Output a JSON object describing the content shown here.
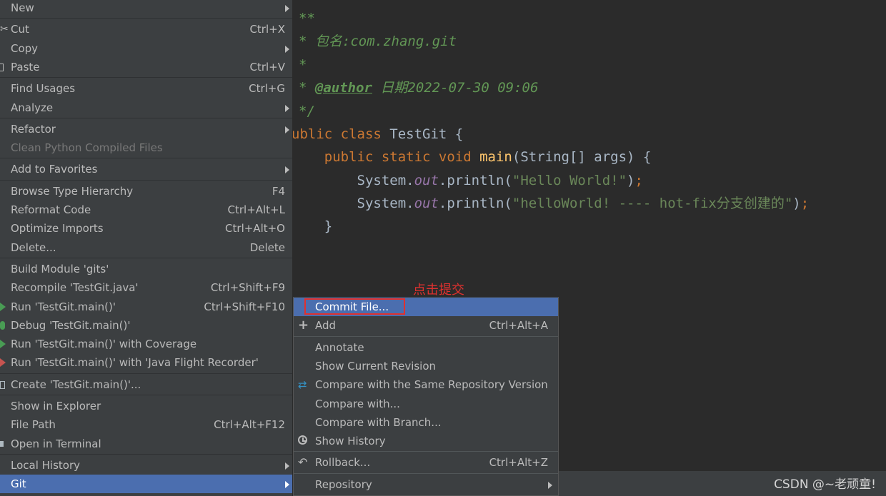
{
  "editor": {
    "lines": [
      {
        "parts": [
          {
            "cls": "cm",
            "text": "**"
          }
        ]
      },
      {
        "parts": [
          {
            "cls": "cm",
            "text": "* 包名:com.zhang.git"
          }
        ]
      },
      {
        "parts": [
          {
            "cls": "cm",
            "text": "*"
          }
        ]
      },
      {
        "parts": [
          {
            "cls": "cm",
            "text": "* "
          },
          {
            "cls": "cm-tag",
            "text": "@author"
          },
          {
            "cls": "cm",
            "text": " 日期2022-07-30 09:06"
          }
        ]
      },
      {
        "parts": [
          {
            "cls": "cm",
            "text": "*/"
          }
        ]
      },
      {
        "parts": [
          {
            "cls": "kw",
            "text": "ublic class "
          },
          {
            "cls": "",
            "text": "TestGit {"
          }
        ]
      },
      {
        "parts": [
          {
            "cls": "",
            "text": "    "
          },
          {
            "cls": "kw",
            "text": "public static void "
          },
          {
            "cls": "fn",
            "text": "main"
          },
          {
            "cls": "",
            "text": "(String[] args) {"
          }
        ]
      },
      {
        "parts": [
          {
            "cls": "",
            "text": "        System."
          },
          {
            "cls": "fld",
            "text": "out"
          },
          {
            "cls": "",
            "text": ".println("
          },
          {
            "cls": "str",
            "text": "\"Hello World!\""
          },
          {
            "cls": "",
            "text": ")"
          },
          {
            "cls": "kw",
            "text": ";"
          }
        ]
      },
      {
        "parts": [
          {
            "cls": "",
            "text": "        System."
          },
          {
            "cls": "fld",
            "text": "out"
          },
          {
            "cls": "",
            "text": ".println("
          },
          {
            "cls": "str",
            "text": "\"helloWorld! ---- hot-fix分支创建的\""
          },
          {
            "cls": "",
            "text": ")"
          },
          {
            "cls": "kw",
            "text": ";"
          }
        ]
      },
      {
        "parts": [
          {
            "cls": "",
            "text": "    }"
          }
        ]
      }
    ]
  },
  "context_menu": {
    "items": [
      {
        "type": "item",
        "id": "new",
        "label": "New",
        "submenu": true
      },
      {
        "type": "sep"
      },
      {
        "type": "item",
        "id": "cut",
        "label": "Cut",
        "shortcut": "Ctrl+X",
        "icon": "cut-icon"
      },
      {
        "type": "item",
        "id": "copy",
        "label": "Copy",
        "submenu": true
      },
      {
        "type": "item",
        "id": "paste",
        "label": "Paste",
        "shortcut": "Ctrl+V",
        "icon": "paste-icon"
      },
      {
        "type": "sep"
      },
      {
        "type": "item",
        "id": "find-usages",
        "label": "Find Usages",
        "shortcut": "Ctrl+G"
      },
      {
        "type": "item",
        "id": "analyze",
        "label": "Analyze",
        "submenu": true
      },
      {
        "type": "sep"
      },
      {
        "type": "item",
        "id": "refactor",
        "label": "Refactor",
        "submenu": true
      },
      {
        "type": "item",
        "id": "clean-python",
        "label": "Clean Python Compiled Files",
        "disabled": true
      },
      {
        "type": "sep"
      },
      {
        "type": "item",
        "id": "add-to-favorites",
        "label": "Add to Favorites",
        "submenu": true
      },
      {
        "type": "sep"
      },
      {
        "type": "item",
        "id": "browse-type-hierarchy",
        "label": "Browse Type Hierarchy",
        "shortcut": "F4"
      },
      {
        "type": "item",
        "id": "reformat-code",
        "label": "Reformat Code",
        "shortcut": "Ctrl+Alt+L"
      },
      {
        "type": "item",
        "id": "optimize-imports",
        "label": "Optimize Imports",
        "shortcut": "Ctrl+Alt+O"
      },
      {
        "type": "item",
        "id": "delete",
        "label": "Delete...",
        "shortcut": "Delete"
      },
      {
        "type": "sep"
      },
      {
        "type": "item",
        "id": "build-module",
        "label": "Build Module 'gits'"
      },
      {
        "type": "item",
        "id": "recompile",
        "label": "Recompile 'TestGit.java'",
        "shortcut": "Ctrl+Shift+F9"
      },
      {
        "type": "item",
        "id": "run",
        "label": "Run 'TestGit.main()'",
        "shortcut": "Ctrl+Shift+F10",
        "icon": "run-icon"
      },
      {
        "type": "item",
        "id": "debug",
        "label": "Debug 'TestGit.main()'",
        "icon": "bug-icon"
      },
      {
        "type": "item",
        "id": "run-coverage",
        "label": "Run 'TestGit.main()' with Coverage",
        "icon": "run-icon"
      },
      {
        "type": "item",
        "id": "run-jfr",
        "label": "Run 'TestGit.main()' with 'Java Flight Recorder'",
        "icon": "run-red-icon"
      },
      {
        "type": "sep"
      },
      {
        "type": "item",
        "id": "create-config",
        "label": "Create 'TestGit.main()'...",
        "icon": "create-icon"
      },
      {
        "type": "sep"
      },
      {
        "type": "item",
        "id": "show-in-explorer",
        "label": "Show in Explorer"
      },
      {
        "type": "item",
        "id": "file-path",
        "label": "File Path",
        "shortcut": "Ctrl+Alt+F12"
      },
      {
        "type": "item",
        "id": "open-in-terminal",
        "label": "Open in Terminal",
        "icon": "terminal-icon"
      },
      {
        "type": "sep"
      },
      {
        "type": "item",
        "id": "local-history",
        "label": "Local History",
        "submenu": true
      },
      {
        "type": "item",
        "id": "git",
        "label": "Git",
        "submenu": true,
        "selected": true
      }
    ]
  },
  "git_menu": {
    "items": [
      {
        "type": "item",
        "id": "commit-file",
        "label": "Commit File...",
        "selected": true
      },
      {
        "type": "item",
        "id": "add",
        "label": "Add",
        "shortcut": "Ctrl+Alt+A",
        "icon": "plus-icon"
      },
      {
        "type": "sep"
      },
      {
        "type": "item",
        "id": "annotate",
        "label": "Annotate"
      },
      {
        "type": "item",
        "id": "show-current-revision",
        "label": "Show Current Revision"
      },
      {
        "type": "item",
        "id": "compare-same-repo",
        "label": "Compare with the Same Repository Version",
        "icon": "compare-icon"
      },
      {
        "type": "item",
        "id": "compare-with",
        "label": "Compare with..."
      },
      {
        "type": "item",
        "id": "compare-with-branch",
        "label": "Compare with Branch..."
      },
      {
        "type": "item",
        "id": "show-history",
        "label": "Show History",
        "icon": "clock-icon"
      },
      {
        "type": "sep"
      },
      {
        "type": "item",
        "id": "rollback",
        "label": "Rollback...",
        "shortcut": "Ctrl+Alt+Z",
        "icon": "rollback-icon"
      },
      {
        "type": "sep"
      },
      {
        "type": "item",
        "id": "repository",
        "label": "Repository",
        "submenu": true
      }
    ]
  },
  "annotation": {
    "text": "点击提交"
  },
  "watermark": {
    "text": "CSDN @~老顽童!"
  },
  "colors": {
    "menu_bg": "#3c3f41",
    "selection": "#4b6eaf",
    "annotation_red": "#e0312f",
    "editor_bg": "#2b2b2b"
  }
}
